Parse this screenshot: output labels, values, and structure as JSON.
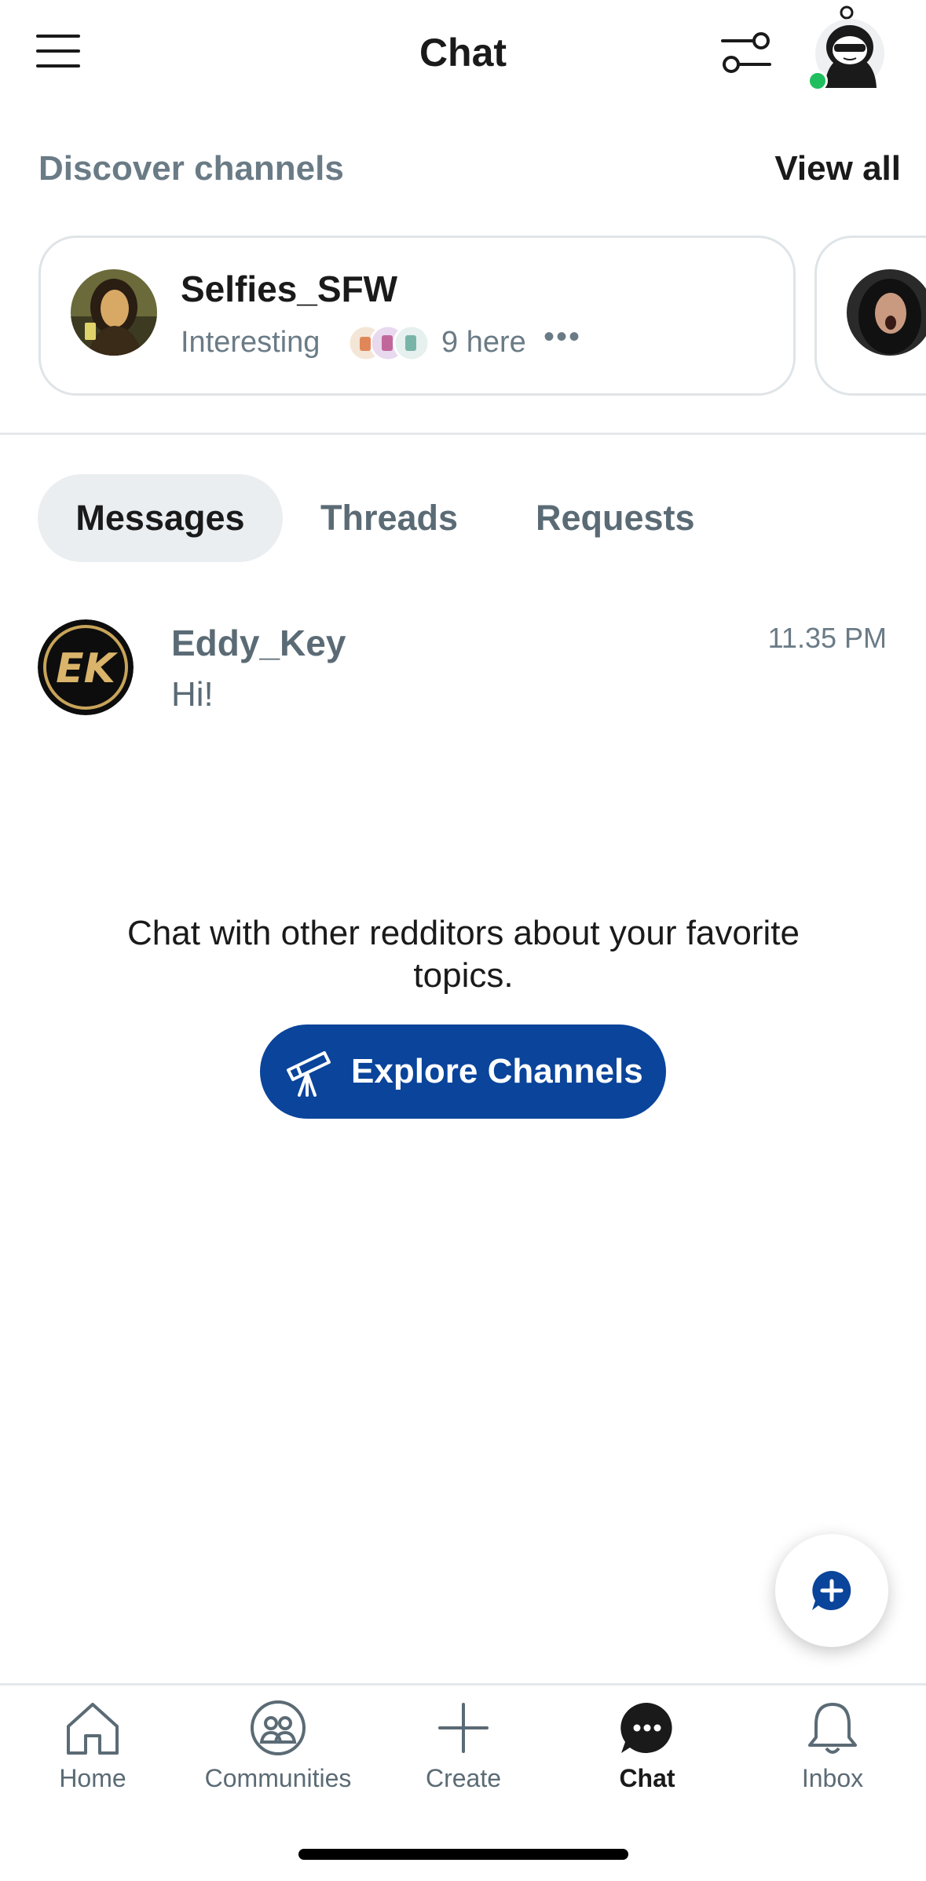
{
  "header": {
    "title": "Chat",
    "online_color": "#1fbf5f"
  },
  "discover": {
    "title": "Discover channels",
    "view_all": "View all",
    "channels": [
      {
        "name": "Selfies_SFW",
        "description": "Interesting",
        "here": "9 here",
        "more": "•••",
        "avatar_icon": "mona-lisa-avatar"
      },
      {
        "avatar_icon": "screaming-person-avatar"
      }
    ]
  },
  "tabs": [
    {
      "label": "Messages",
      "active": true
    },
    {
      "label": "Threads",
      "active": false
    },
    {
      "label": "Requests",
      "active": false
    }
  ],
  "messages": [
    {
      "name": "Eddy_Key",
      "text": "Hi!",
      "time": "11.35 PM",
      "avatar_icon": "ek-logo-avatar"
    }
  ],
  "empty_state": {
    "text": "Chat with other redditors about your favorite topics.",
    "button_label": "Explore Channels",
    "button_color": "#0a449b",
    "button_icon": "telescope-icon"
  },
  "fab": {
    "icon": "new-chat-plus-icon",
    "color": "#0a449b"
  },
  "bottom_nav": [
    {
      "label": "Home",
      "icon": "home-icon",
      "active": false
    },
    {
      "label": "Communities",
      "icon": "communities-icon",
      "active": false
    },
    {
      "label": "Create",
      "icon": "plus-icon",
      "active": false
    },
    {
      "label": "Chat",
      "icon": "chat-bubble-icon",
      "active": true
    },
    {
      "label": "Inbox",
      "icon": "bell-icon",
      "active": false
    }
  ]
}
